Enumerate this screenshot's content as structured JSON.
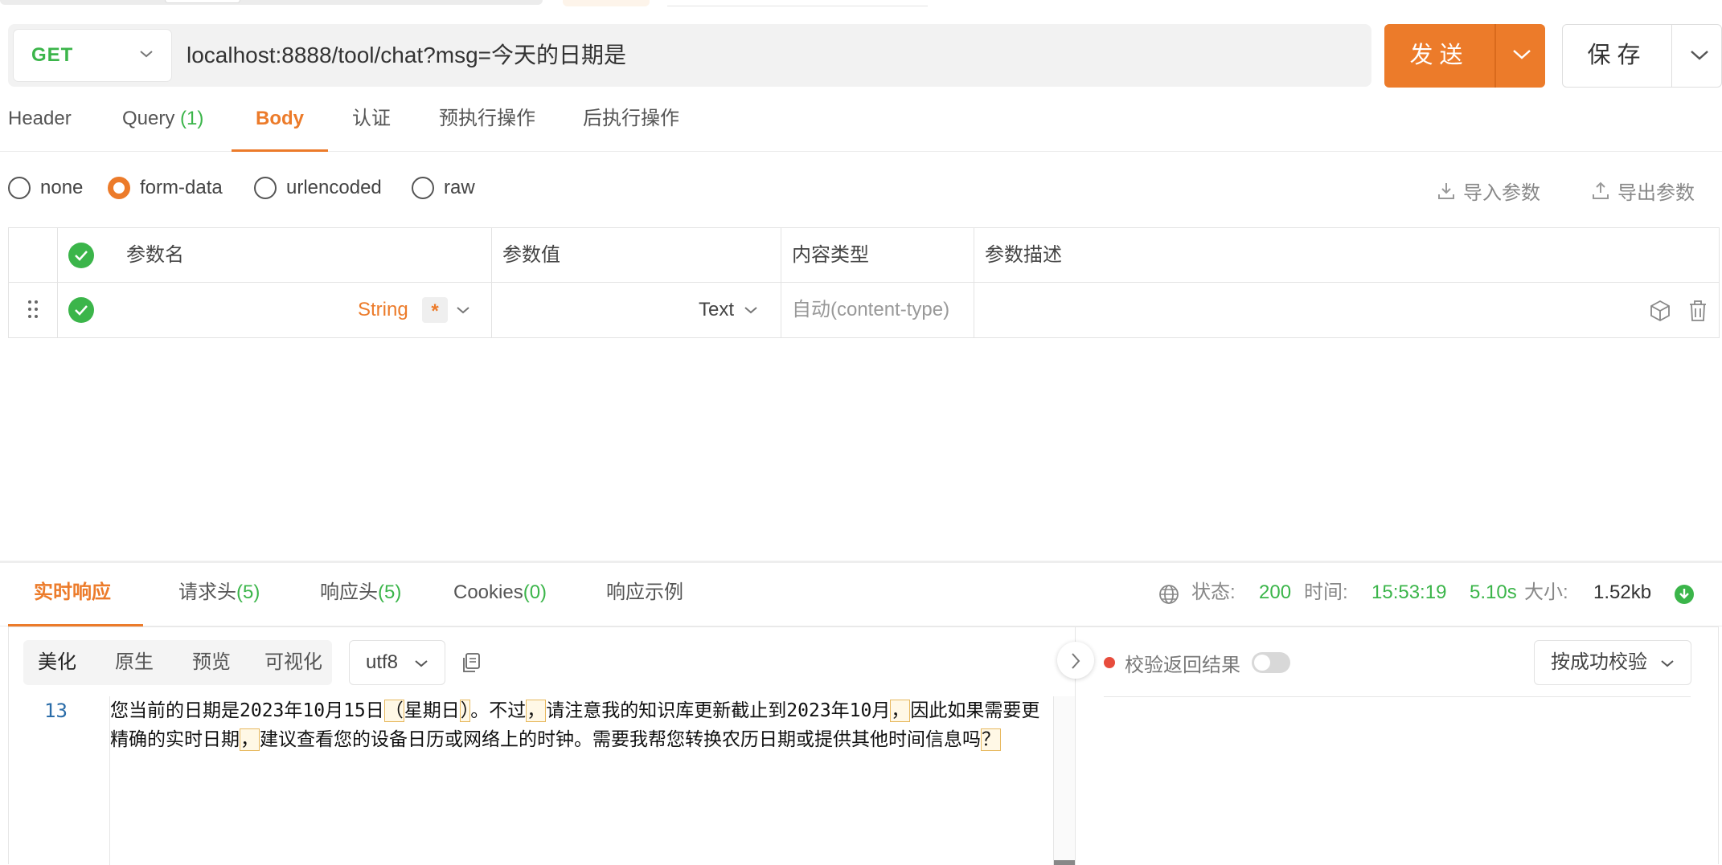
{
  "request": {
    "method": "GET",
    "url": "localhost:8888/tool/chat?msg=今天的日期是",
    "send_label": "发送",
    "save_label": "保存"
  },
  "request_tabs": [
    {
      "label": "Header",
      "count": ""
    },
    {
      "label": "Query ",
      "count": "(1)"
    },
    {
      "label": "Body",
      "count": ""
    },
    {
      "label": "认证",
      "count": ""
    },
    {
      "label": "预执行操作",
      "count": ""
    },
    {
      "label": "后执行操作",
      "count": ""
    }
  ],
  "active_request_tab": "Body",
  "body_types": [
    "none",
    "form-data",
    "urlencoded",
    "raw"
  ],
  "selected_body_type": "form-data",
  "body_tools": {
    "import": "导入参数",
    "export": "导出参数"
  },
  "param_table": {
    "headers": [
      "参数名",
      "参数值",
      "内容类型",
      "参数描述"
    ],
    "row": {
      "name": "",
      "type": "String",
      "required_mark": "*",
      "value_type": "Text",
      "content_type": "自动(content-type)",
      "description": ""
    }
  },
  "response_tabs": [
    {
      "label": "实时响应",
      "count": ""
    },
    {
      "label": "请求头",
      "count": "(5)"
    },
    {
      "label": "响应头",
      "count": "(5)"
    },
    {
      "label": "Cookies",
      "count": "(0)"
    },
    {
      "label": "响应示例",
      "count": ""
    }
  ],
  "active_response_tab": "实时响应",
  "status": {
    "status_label": "状态:",
    "status_code": "200",
    "time_label": "时间:",
    "time_value": "15:53:19",
    "duration": "5.10s",
    "size_label": "大小:",
    "size_value": "1.52kb"
  },
  "view_modes": [
    "美化",
    "原生",
    "预览",
    "可视化"
  ],
  "active_view_mode": "美化",
  "encoding": "utf8",
  "editor": {
    "line_number": "13",
    "segments": [
      {
        "t": "您当前的日期是2023年10月15日",
        "m": false
      },
      {
        "t": "（",
        "m": true
      },
      {
        "t": "星期日",
        "m": false
      },
      {
        "t": "）",
        "m": true
      },
      {
        "t": "。不过",
        "m": false
      },
      {
        "t": "，",
        "m": true
      },
      {
        "t": "请注意我的知识库更新截止到2023年10月",
        "m": false
      },
      {
        "t": "，",
        "m": true
      },
      {
        "t": "因此如果需要更精确的实时日期",
        "m": false
      },
      {
        "t": "，",
        "m": true
      },
      {
        "t": "建议查看您的设备日历或网络上的时钟。需要我帮您转换农历日期或提供其他时间信息吗",
        "m": false
      },
      {
        "t": "？",
        "m": true
      }
    ]
  },
  "verify": {
    "label": "校验返回结果",
    "enabled": false,
    "mode": "按成功校验"
  },
  "colors": {
    "accent": "#ec7b2a",
    "success": "#3bb54a",
    "danger": "#e74c3c"
  }
}
